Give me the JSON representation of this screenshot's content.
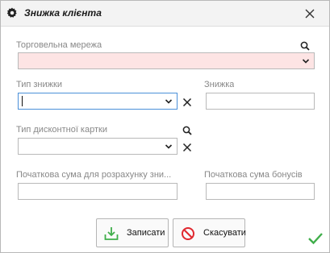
{
  "window": {
    "title": "Знижка клієнта"
  },
  "fields": {
    "retail_network": {
      "label": "Торговельна мережа",
      "value": ""
    },
    "discount_type": {
      "label": "Тип знижки",
      "value": ""
    },
    "discount": {
      "label": "Знижка",
      "value": ""
    },
    "card_type": {
      "label": "Тип дисконтної картки",
      "value": ""
    },
    "start_sum": {
      "label": "Початкова сума для розрахунку зни...",
      "value": ""
    },
    "bonus_sum": {
      "label": "Початкова сума бонусів",
      "value": ""
    }
  },
  "buttons": {
    "save": "Записати",
    "cancel": "Скасувати"
  },
  "colors": {
    "required_field_bg": "#fde4e4",
    "save_icon": "#3fae4a",
    "cancel_icon": "#e0282f",
    "ok_check": "#3fae4a"
  }
}
